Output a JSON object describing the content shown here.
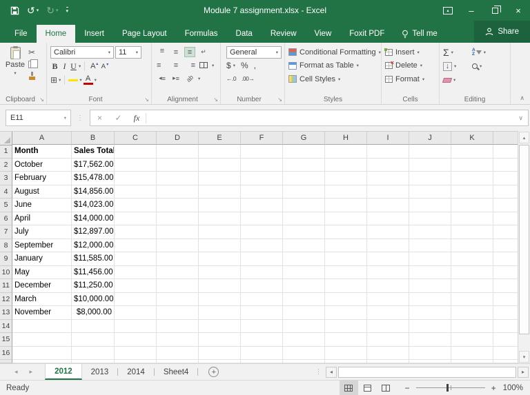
{
  "titlebar": {
    "title": "Module 7 assignment.xlsx  -  Excel"
  },
  "ribbon_tabs": {
    "items": [
      "File",
      "Home",
      "Insert",
      "Page Layout",
      "Formulas",
      "Data",
      "Review",
      "View",
      "Foxit PDF"
    ],
    "active": "Home"
  },
  "tellme": {
    "label": "Tell me"
  },
  "share": {
    "label": "Share"
  },
  "ribbon": {
    "clipboard": {
      "label": "Clipboard",
      "paste": "Paste"
    },
    "font": {
      "label": "Font",
      "family": "Calibri",
      "size": "11"
    },
    "alignment": {
      "label": "Alignment"
    },
    "number": {
      "label": "Number",
      "format": "General"
    },
    "styles": {
      "label": "Styles",
      "conditional_formatting": "Conditional Formatting",
      "format_as_table": "Format as Table",
      "cell_styles": "Cell Styles"
    },
    "cells": {
      "label": "Cells",
      "insert": "Insert",
      "delete": "Delete",
      "format": "Format"
    },
    "editing": {
      "label": "Editing"
    }
  },
  "formula_bar": {
    "name_box": "E11",
    "formula": "",
    "fx": "fx"
  },
  "sheet": {
    "columns": [
      "A",
      "B",
      "C",
      "D",
      "E",
      "F",
      "G",
      "H",
      "I",
      "J",
      "K"
    ],
    "visible_rows": 16,
    "data": [
      [
        "Month",
        "Sales Total"
      ],
      [
        "October",
        "$17,562.00"
      ],
      [
        "February",
        "$15,478.00"
      ],
      [
        "August",
        "$14,856.00"
      ],
      [
        "June",
        "$14,023.00"
      ],
      [
        "April",
        "$14,000.00"
      ],
      [
        "July",
        "$12,897.00"
      ],
      [
        "September",
        "$12,000.00"
      ],
      [
        "January",
        "$11,585.00"
      ],
      [
        "May",
        "$11,456.00"
      ],
      [
        "December",
        "$11,250.00"
      ],
      [
        "March",
        "$10,000.00"
      ],
      [
        "November",
        "$8,000.00"
      ]
    ]
  },
  "sheet_tabs": {
    "items": [
      "2012",
      "2013",
      "2014",
      "Sheet4"
    ],
    "active": "2012"
  },
  "status_bar": {
    "status": "Ready",
    "zoom_level": "100%"
  },
  "colors": {
    "accent_green": "#217346",
    "fill_yellow": "#ffe400",
    "font_red": "#c00000"
  },
  "icons": {
    "undo": "↺",
    "redo": "↻",
    "caret": "▾",
    "minimize": "–",
    "close": "×",
    "cut": "✂",
    "bold": "B",
    "italic": "I",
    "underline": "U",
    "grow_font": "A",
    "shrink_font": "A",
    "font_color": "A",
    "borders": "⊞",
    "dollar": "$",
    "percent": "%",
    "comma": ",",
    "inc_decimal": "←.0",
    "dec_decimal": ".00→",
    "align_lines": "≡",
    "wrap_return": "↵",
    "orientation": "ab",
    "autosum": "Σ",
    "fill_arrow": "↓",
    "sort_a": "A",
    "sort_z": "Z",
    "check": "✓",
    "cancel": "×",
    "formula_chevron": "∨",
    "collapse_ribbon": "∧",
    "nav_left": "◂",
    "nav_right": "▸",
    "add_sheet": "+",
    "dots": "⋮",
    "zoom_out": "−",
    "zoom_in": "+",
    "launcher": "↘",
    "scroll_up": "▲",
    "scroll_down": "▼",
    "up_tiny": "▴",
    "down_tiny": "▾",
    "rdo_arrow": "▴"
  }
}
